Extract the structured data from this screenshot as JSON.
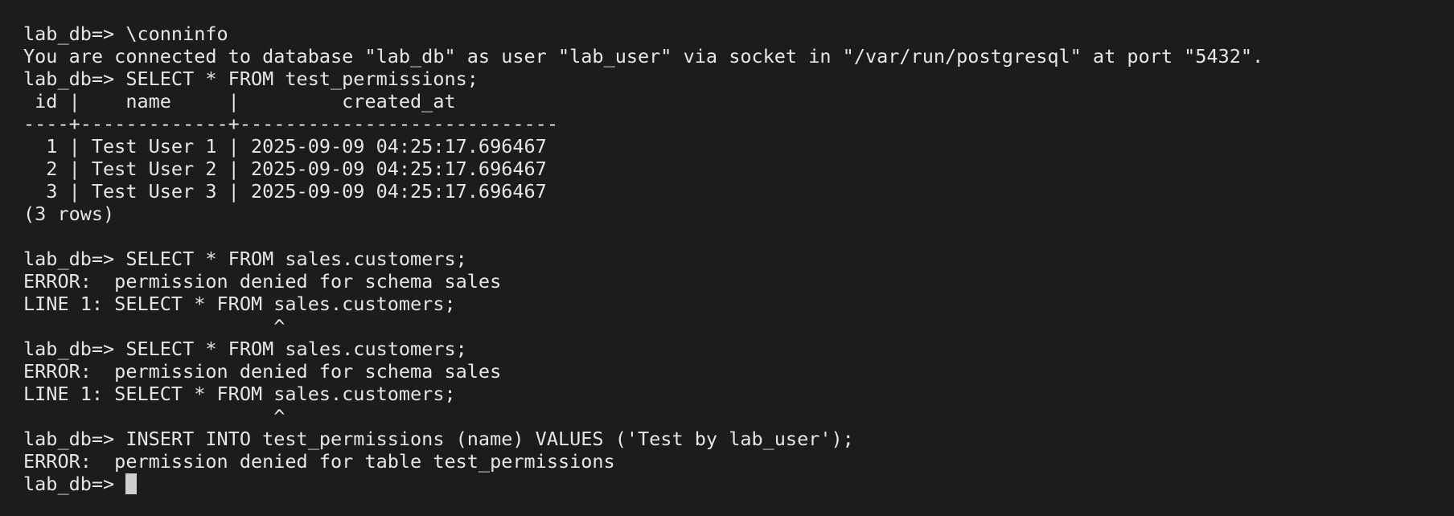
{
  "terminal": {
    "lines": [
      "lab_db=> \\conninfo",
      "You are connected to database \"lab_db\" as user \"lab_user\" via socket in \"/var/run/postgresql\" at port \"5432\".",
      "lab_db=> SELECT * FROM test_permissions;",
      " id |    name     |         created_at",
      "----+-------------+----------------------------",
      "  1 | Test User 1 | 2025-09-09 04:25:17.696467",
      "  2 | Test User 2 | 2025-09-09 04:25:17.696467",
      "  3 | Test User 3 | 2025-09-09 04:25:17.696467",
      "(3 rows)",
      "",
      "lab_db=> SELECT * FROM sales.customers;",
      "ERROR:  permission denied for schema sales",
      "LINE 1: SELECT * FROM sales.customers;",
      "                      ^",
      "lab_db=> SELECT * FROM sales.customers;",
      "ERROR:  permission denied for schema sales",
      "LINE 1: SELECT * FROM sales.customers;",
      "                      ^",
      "lab_db=> INSERT INTO test_permissions (name) VALUES ('Test by lab_user');",
      "ERROR:  permission denied for table test_permissions"
    ],
    "prompt": "lab_db=> "
  }
}
